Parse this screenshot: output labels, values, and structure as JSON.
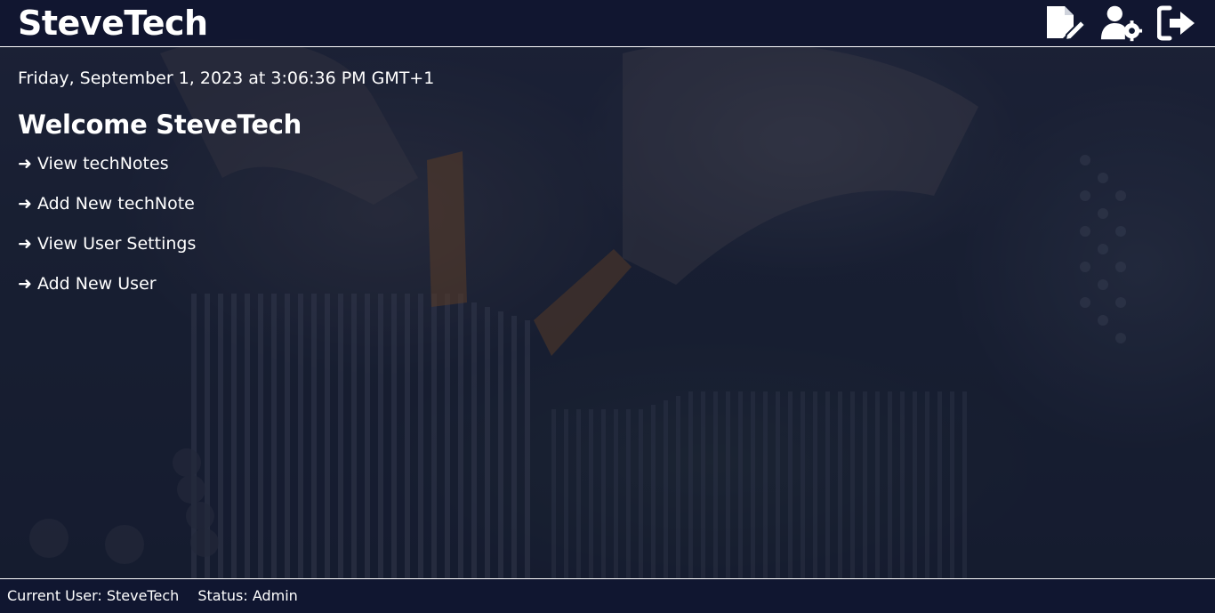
{
  "header": {
    "title": "SteveTech",
    "icons": [
      "edit-note-icon",
      "user-settings-icon",
      "logout-icon"
    ]
  },
  "main": {
    "datetime": "Friday, September 1, 2023 at 3:06:36 PM GMT+1",
    "welcome": "Welcome SteveTech",
    "links": [
      {
        "label": "➜ View techNotes"
      },
      {
        "label": "➜ Add New techNote"
      },
      {
        "label": "➜ View User Settings"
      },
      {
        "label": "➜ Add New User"
      }
    ]
  },
  "footer": {
    "current_user": "Current User: SteveTech",
    "status": "Status: Admin"
  },
  "colors": {
    "header_bg": "#101630",
    "text": "#ffffff"
  }
}
